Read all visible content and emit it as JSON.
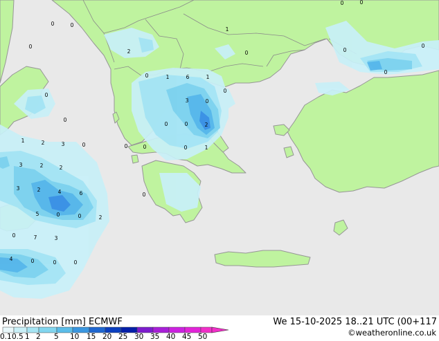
{
  "title": "Precipitation [mm] ECMWF",
  "valid_time": "We 15-10-2025 18..21 UTC (00+117",
  "credit": "©weatheronline.co.uk",
  "colors": {
    "sea": "#e9e9e9",
    "land": "#bff39f",
    "coast": "#969696",
    "border": "#8a8a8a",
    "p01": "#c8f0f8",
    "p05": "#a4e4f4",
    "p1": "#7cd2ee",
    "p2": "#56b6ea",
    "p5": "#3a8ee4"
  },
  "legend": {
    "ticks": [
      "0.1",
      "0.5",
      "1",
      "2",
      "5",
      "10",
      "15",
      "20",
      "25",
      "30",
      "35",
      "40",
      "45",
      "50"
    ],
    "colors": [
      "#e9f8fb",
      "#c9f0f8",
      "#a6e5f4",
      "#82d6ef",
      "#5bbde9",
      "#3b97e0",
      "#1f67d0",
      "#0b3fbf",
      "#051fa8",
      "#7d1ccd",
      "#a81fd8",
      "#cc22e0",
      "#e224d8",
      "#f12fc8"
    ]
  },
  "map_labels": [
    {
      "v": "0"
    },
    {
      "v": "0"
    },
    {
      "v": "0"
    },
    {
      "v": "0"
    },
    {
      "v": "1"
    },
    {
      "v": "0"
    },
    {
      "v": "2"
    },
    {
      "v": "0"
    },
    {
      "v": "0"
    },
    {
      "v": "0"
    },
    {
      "v": "0"
    },
    {
      "v": "0"
    },
    {
      "v": "1"
    },
    {
      "v": "6"
    },
    {
      "v": "1"
    },
    {
      "v": "0"
    },
    {
      "v": "0"
    },
    {
      "v": "3"
    },
    {
      "v": "0"
    },
    {
      "v": "0"
    },
    {
      "v": "0"
    },
    {
      "v": "0"
    },
    {
      "v": "2"
    },
    {
      "v": "1"
    },
    {
      "v": "2"
    },
    {
      "v": "3"
    },
    {
      "v": "0"
    },
    {
      "v": "0"
    },
    {
      "v": "0"
    },
    {
      "v": "0"
    },
    {
      "v": "1"
    },
    {
      "v": "3"
    },
    {
      "v": "2"
    },
    {
      "v": "2"
    },
    {
      "v": "3"
    },
    {
      "v": "2"
    },
    {
      "v": "4"
    },
    {
      "v": "6"
    },
    {
      "v": "5"
    },
    {
      "v": "0"
    },
    {
      "v": "0"
    },
    {
      "v": "2"
    },
    {
      "v": "0"
    },
    {
      "v": "0"
    },
    {
      "v": "7"
    },
    {
      "v": "3"
    },
    {
      "v": "4"
    },
    {
      "v": "0"
    },
    {
      "v": "0"
    },
    {
      "v": "0"
    }
  ]
}
